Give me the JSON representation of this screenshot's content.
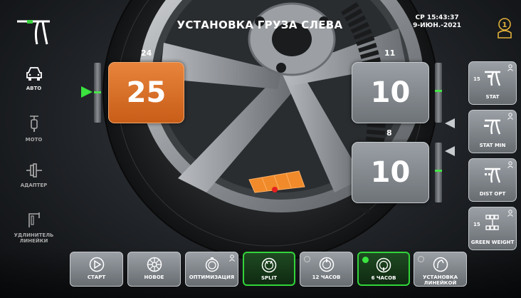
{
  "header": {
    "title": "УСТАНОВКА ГРУЗА СЛЕВА",
    "time": "СР 15:43:37",
    "date": "9-ИЮН.-2021",
    "user_number": "1"
  },
  "sidebar_left": {
    "items": [
      {
        "label": "АВТО",
        "icon": "car-icon",
        "active": true
      },
      {
        "label": "МОТО",
        "icon": "motorcycle-icon",
        "active": false
      },
      {
        "label": "АДАПТЕР",
        "icon": "adapter-icon",
        "active": false
      },
      {
        "label": "УДЛИНИТЕЛЬ ЛИНЕЙКИ",
        "icon": "ruler-extension-icon",
        "active": false
      }
    ]
  },
  "left_plane": {
    "residual": "24",
    "weight": "25"
  },
  "right_plane_outer": {
    "residual": "11",
    "weight": "10"
  },
  "right_plane_inner": {
    "residual": "8",
    "weight": "10"
  },
  "sidebar_right": {
    "items": [
      {
        "label": "STAT",
        "number": "15",
        "icon": "stat-weight-icon"
      },
      {
        "label": "STAT MIN",
        "number": "",
        "icon": "stat-min-icon"
      },
      {
        "label": "DIST OPT",
        "number": "",
        "icon": "dist-opt-icon"
      },
      {
        "label": "GREEN WEIGHT",
        "number": "15",
        "icon": "green-weight-icon"
      }
    ]
  },
  "bottom_toolbar": {
    "items": [
      {
        "label": "СТАРТ",
        "icon": "play-icon"
      },
      {
        "label": "НОВОЕ",
        "icon": "new-wheel-icon"
      },
      {
        "label": "ОПТИМИЗАЦИЯ",
        "icon": "optimization-icon"
      },
      {
        "label": "SPLIT",
        "icon": "split-icon"
      },
      {
        "label": "12 ЧАСОВ",
        "icon": "twelve-oclock-icon"
      },
      {
        "label": "6 ЧАСОВ",
        "icon": "six-oclock-icon"
      },
      {
        "label": "УСТАНОВКА ЛИНЕЙКОЙ",
        "icon": "ruler-placement-icon"
      }
    ]
  },
  "colors": {
    "accent_green": "#32d43a",
    "weight_orange": "#e07a30",
    "box_grey": "#8a8f94"
  }
}
